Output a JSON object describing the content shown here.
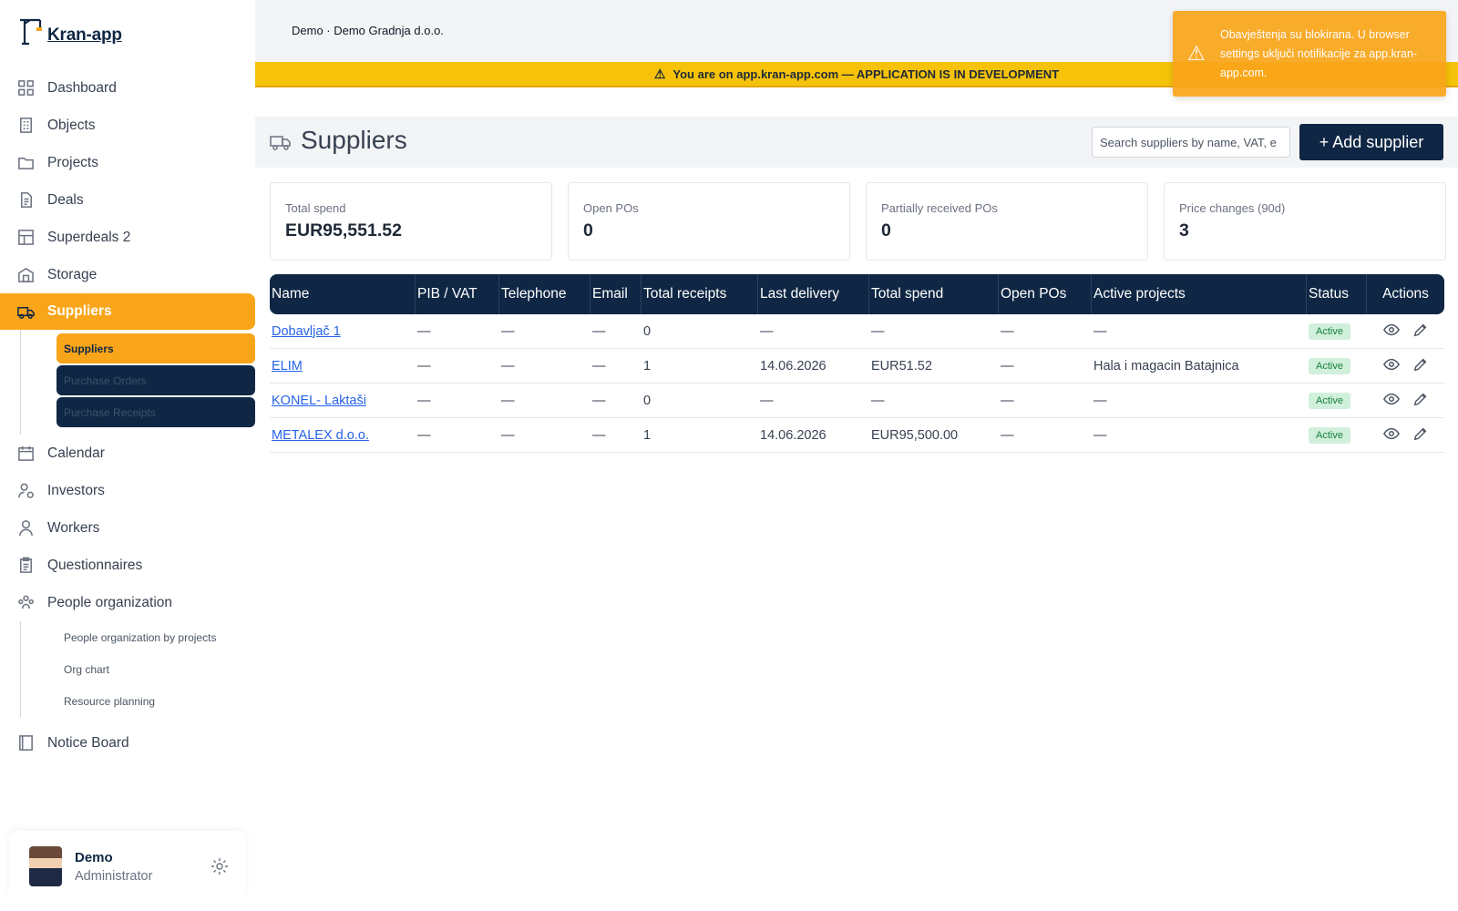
{
  "app": {
    "name": "Kran-app"
  },
  "topbar": {
    "company": "Demo · Demo Gradnja d.o.o."
  },
  "banner": {
    "text": "You are on app.kran-app.com — APPLICATION IS IN DEVELOPMENT"
  },
  "toast": {
    "message": "Obavještenja su blokirana. U browser settings uključi notifikacije za app.kran-app.com."
  },
  "sidebar": {
    "items": [
      {
        "label": "Dashboard",
        "icon": "dashboard-icon"
      },
      {
        "label": "Objects",
        "icon": "building-icon"
      },
      {
        "label": "Projects",
        "icon": "folder-icon"
      },
      {
        "label": "Deals",
        "icon": "document-icon"
      },
      {
        "label": "Superdeals 2",
        "icon": "grid-icon"
      },
      {
        "label": "Storage",
        "icon": "warehouse-icon"
      },
      {
        "label": "Suppliers",
        "icon": "truck-icon",
        "active": true
      },
      {
        "label": "Calendar",
        "icon": "calendar-icon"
      },
      {
        "label": "Investors",
        "icon": "investor-icon"
      },
      {
        "label": "Workers",
        "icon": "person-icon"
      },
      {
        "label": "Questionnaires",
        "icon": "clipboard-icon"
      },
      {
        "label": "People organization",
        "icon": "people-icon"
      },
      {
        "label": "Notice Board",
        "icon": "board-icon"
      }
    ],
    "suppliers_sub": [
      "Suppliers",
      "Purchase Orders",
      "Purchase Receipts"
    ],
    "people_sub": [
      "People organization by projects",
      "Org chart",
      "Resource planning"
    ]
  },
  "user": {
    "name": "Demo",
    "role": "Administrator"
  },
  "page": {
    "title": "Suppliers",
    "search_placeholder": "Search suppliers by name, VAT, e",
    "add_label": "+ Add supplier"
  },
  "kpis": [
    {
      "label": "Total spend",
      "value": "EUR95,551.52"
    },
    {
      "label": "Open POs",
      "value": "0"
    },
    {
      "label": "Partially received POs",
      "value": "0"
    },
    {
      "label": "Price changes (90d)",
      "value": "3"
    }
  ],
  "table": {
    "columns": [
      "Name",
      "PIB / VAT",
      "Telephone",
      "Email",
      "Total receipts",
      "Last delivery",
      "Total spend",
      "Open POs",
      "Active projects",
      "Status",
      "Actions"
    ],
    "rows": [
      [
        "Dobavljač 1",
        "—",
        "—",
        "—",
        "0",
        "—",
        "—",
        "—",
        "—",
        "Active"
      ],
      [
        "ELIM",
        "—",
        "—",
        "—",
        "1",
        "14.06.2026",
        "EUR51.52",
        "—",
        "Hala i magacin Batajnica",
        "Active"
      ],
      [
        "KONEL- Laktaši",
        "—",
        "—",
        "—",
        "0",
        "—",
        "—",
        "—",
        "—",
        "Active"
      ],
      [
        "METALEX d.o.o.",
        "—",
        "—",
        "—",
        "1",
        "14.06.2026",
        "EUR95,500.00",
        "—",
        "—",
        "Active"
      ]
    ]
  },
  "colors": {
    "navy": "#0f2744",
    "accent": "#f9a51a",
    "banner": "#f6c30a",
    "status_green": "#15803d"
  }
}
